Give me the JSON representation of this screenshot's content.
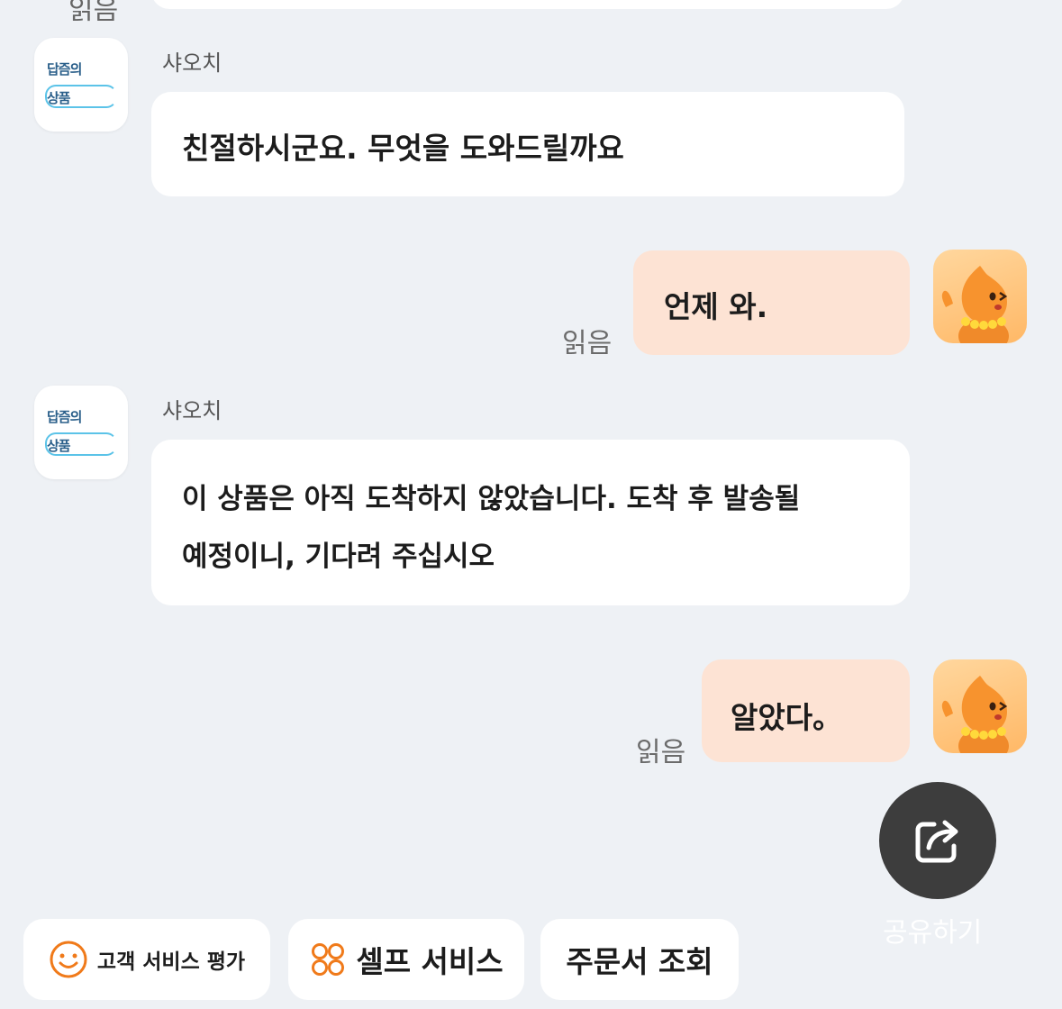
{
  "sender_name": "샤오치",
  "bot_avatar": {
    "line1": "답즘의",
    "line2": "상품"
  },
  "read_label": "읽음",
  "messages": {
    "bot1": "친절하시군요. 무엇을 도와드릴까요",
    "user1": "언제 와.",
    "bot2_line1": "이 상품은 아직 도착하지 않았습니다. 도착 후 발송될",
    "bot2_line2": "예정이니, 기다려 주십시오",
    "user2": "알았다。"
  },
  "share": {
    "label": "공유하기",
    "icon": "share-icon"
  },
  "bottom_bar": {
    "rating": {
      "label": "고객 서비스 평가",
      "icon": "smiley-icon"
    },
    "self_service": {
      "label": "셀프 서비스",
      "icon": "self-service-icon"
    },
    "order_lookup": {
      "label": "주문서 조회"
    }
  },
  "colors": {
    "background": "#eef1f5",
    "user_bubble": "#fde3d4",
    "accent_orange": "#f07a1a",
    "share_fab": "#3d3d3d"
  }
}
